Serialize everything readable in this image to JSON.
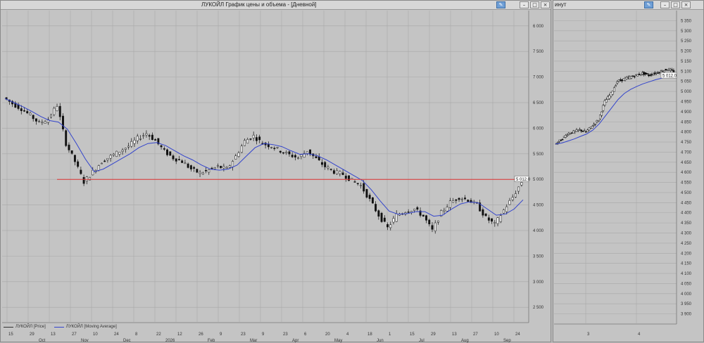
{
  "window_main": {
    "title": "ЛУКОЙЛ График цены и объема - [Дневной]"
  },
  "window_side": {
    "title": "инут"
  },
  "colors": {
    "background": "#c4c4c4",
    "grid": "#a8a8a8",
    "candle": "#111111",
    "moving_average": "#3344cc",
    "level_line": "#dd3333",
    "axis_text": "#333333"
  },
  "legend": {
    "price_label": "ЛУКОЙЛ [Price]",
    "ma_label": "ЛУКОЙЛ [Moving Average]"
  },
  "chart_data": [
    {
      "type": "candlestick",
      "title": "",
      "y_ticks": [
        "6 000",
        "7 500",
        "7 000",
        "6 500",
        "6 000",
        "5 500",
        "5 000",
        "4 500",
        "4 000",
        "3 500",
        "3 000",
        "2 500"
      ],
      "y_tick_values": [
        8000,
        7500,
        7000,
        6500,
        6000,
        5500,
        5000,
        4500,
        4000,
        3500,
        3000,
        2500
      ],
      "ylim": [
        2200,
        8300
      ],
      "x_day_labels": [
        "15",
        "29",
        "13",
        "27",
        "10",
        "24",
        "8",
        "22",
        "12",
        "26",
        "9",
        "23",
        "9",
        "23",
        "6",
        "20",
        "4",
        "18",
        "1",
        "15",
        "29",
        "13",
        "27",
        "10",
        "24"
      ],
      "x_month_labels": [
        "Oct",
        "Nov",
        "Dec",
        "2026",
        "Feb",
        "Mar",
        "Apr",
        "May",
        "Jun",
        "Jul",
        "Aug",
        "Sep"
      ],
      "last_price_label": "5 012.0",
      "level_line_value": 5000,
      "price_series": [
        6600,
        6480,
        6380,
        6250,
        6100,
        6180,
        6450,
        5700,
        5350,
        4950,
        5150,
        5350,
        5450,
        5550,
        5650,
        5800,
        5900,
        5760,
        5550,
        5420,
        5350,
        5200,
        5120,
        5180,
        5250,
        5200,
        5450,
        5750,
        5850,
        5700,
        5650,
        5560,
        5480,
        5420,
        5560,
        5400,
        5250,
        5150,
        5100,
        4980,
        4880,
        4600,
        4300,
        4050,
        4300,
        4380,
        4420,
        4280,
        4000,
        4350,
        4550,
        4650,
        4600,
        4500,
        4250,
        4120,
        4400,
        4650,
        4950
      ],
      "ma_series": [
        6580,
        6500,
        6420,
        6330,
        6230,
        6150,
        6120,
        5980,
        5700,
        5400,
        5150,
        5200,
        5300,
        5400,
        5500,
        5620,
        5700,
        5720,
        5660,
        5560,
        5460,
        5380,
        5280,
        5200,
        5180,
        5200,
        5280,
        5450,
        5620,
        5700,
        5680,
        5640,
        5560,
        5490,
        5500,
        5460,
        5380,
        5280,
        5180,
        5080,
        4980,
        4800,
        4580,
        4380,
        4320,
        4330,
        4370,
        4370,
        4280,
        4300,
        4420,
        4520,
        4560,
        4540,
        4420,
        4300,
        4320,
        4420,
        4600
      ]
    },
    {
      "type": "candlestick",
      "title": "",
      "y_ticks": [
        "5 350",
        "5 300",
        "5 250",
        "5 200",
        "5 150",
        "5 100",
        "5 050",
        "5 000",
        "4 950",
        "4 900",
        "4 850",
        "4 800",
        "4 750",
        "4 700",
        "4 650",
        "4 600",
        "4 550",
        "4 500",
        "4 450",
        "4 400",
        "4 350",
        "4 300",
        "4 250",
        "4 200",
        "4 150",
        "4 100",
        "4 050",
        "4 000",
        "3 950",
        "3 900"
      ],
      "y_tick_values": [
        5350,
        5300,
        5250,
        5200,
        5150,
        5100,
        5050,
        5000,
        4950,
        4900,
        4850,
        4800,
        4750,
        4700,
        4650,
        4600,
        4550,
        4500,
        4450,
        4400,
        4350,
        4300,
        4250,
        4200,
        4150,
        4100,
        4050,
        4000,
        3950,
        3900
      ],
      "ylim": [
        3850,
        5400
      ],
      "x_day_labels": [
        "3",
        "4"
      ],
      "last_price_label": "5 012.0",
      "price_series": [
        4740,
        4760,
        4790,
        4800,
        4810,
        4800,
        4830,
        4860,
        4950,
        4990,
        5050,
        5060,
        5070,
        5080,
        5090,
        5080,
        5090,
        5100,
        5110,
        5100
      ],
      "ma_series": [
        4740,
        4745,
        4755,
        4765,
        4778,
        4790,
        4810,
        4840,
        4880,
        4920,
        4960,
        4990,
        5010,
        5025,
        5038,
        5048,
        5058,
        5066,
        5074,
        5080
      ]
    }
  ]
}
